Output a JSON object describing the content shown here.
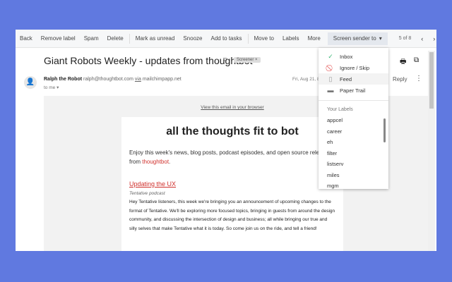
{
  "toolbar": {
    "back": "Back",
    "remove_label": "Remove label",
    "spam": "Spam",
    "delete": "Delete",
    "mark_unread": "Mark as unread",
    "snooze": "Snooze",
    "add_tasks": "Add to tasks",
    "move_to": "Move to",
    "labels": "Labels",
    "more": "More",
    "screen_sender": "Screen sender to",
    "pagination": "5 of 8"
  },
  "email": {
    "subject": "Giant Robots Weekly - updates from thoughtbot",
    "tag": "Screener",
    "sender_name": "Ralph the Robot",
    "sender_email": "ralph@thoughtbot.com",
    "via": "via",
    "via_domain": "mailchimpapp.net",
    "to": "to me",
    "date": "Fri, Aug 21, 8",
    "reply": "Reply"
  },
  "content": {
    "view_link": "View this email in your browser",
    "heading": "all the thoughts fit to bot",
    "intro": "Enjoy this week's news, blog posts, podcast episodes, and open source releases from ",
    "intro_link": "thoughtbot",
    "intro_end": ".",
    "article_title": "Updating the UX",
    "article_sub": "Tentative podcast",
    "article_body": "Hey Tentative listeners, this week we're bringing you an announcement of upcoming changes to the format of Tentative. We'll be exploring more focused topics, bringing in guests from around the design community, and discussing the intersection of design and business; all while bringing our true and silly selves that make Tentative what it is today. So come join us on the ride, and tell a friend!"
  },
  "menu": {
    "options": [
      {
        "label": "Inbox",
        "icon": "check-circle-icon"
      },
      {
        "label": "Ignore / Skip",
        "icon": "block-icon"
      },
      {
        "label": "Feed",
        "icon": "document-icon"
      },
      {
        "label": "Paper Trail",
        "icon": "folder-icon"
      }
    ],
    "labels_heading": "Your Labels",
    "labels": [
      "appcel",
      "career",
      "eh",
      "filter",
      "listserv",
      "miles",
      "mgm"
    ]
  }
}
